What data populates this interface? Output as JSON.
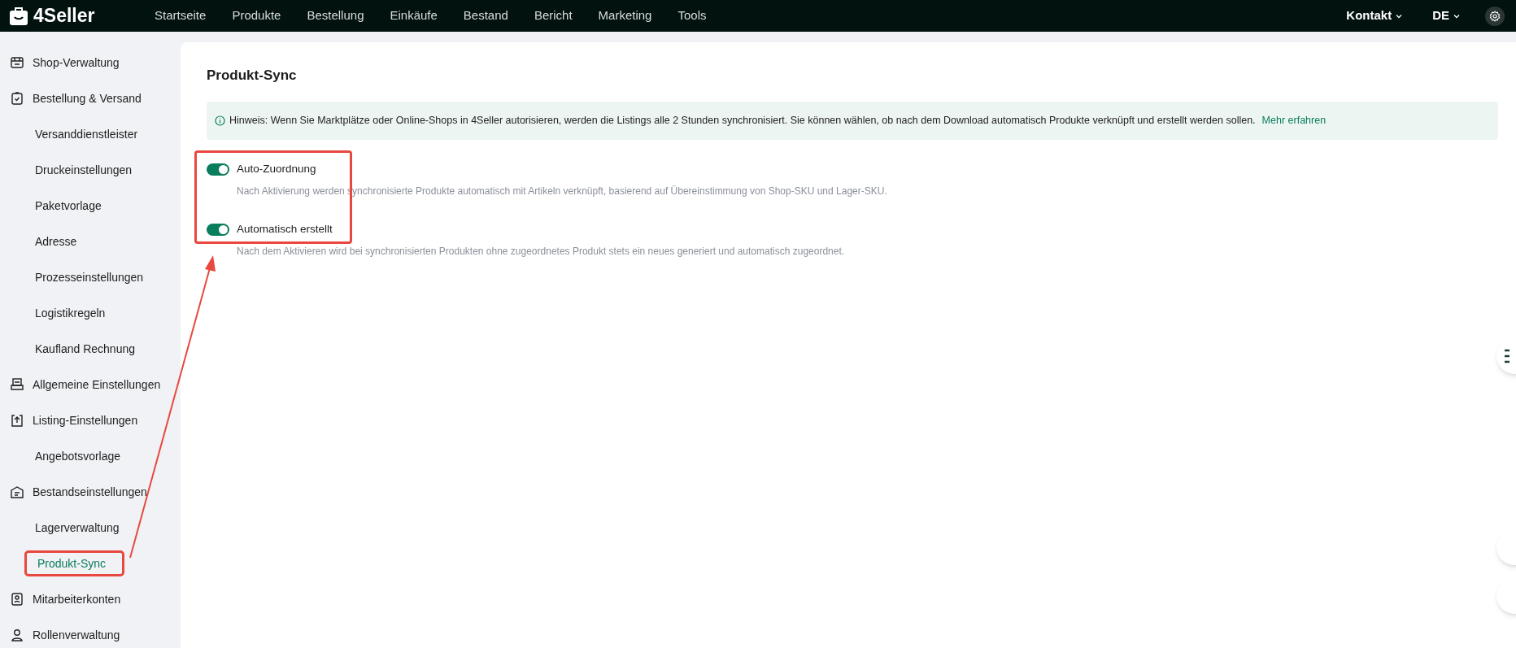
{
  "brand": "4Seller",
  "nav": [
    {
      "label": "Startseite"
    },
    {
      "label": "Produkte"
    },
    {
      "label": "Bestellung"
    },
    {
      "label": "Einkäufe"
    },
    {
      "label": "Bestand"
    },
    {
      "label": "Bericht"
    },
    {
      "label": "Marketing"
    },
    {
      "label": "Tools"
    }
  ],
  "top_right": {
    "contact": "Kontakt",
    "language": "DE"
  },
  "sidebar": [
    {
      "label": "Shop-Verwaltung",
      "selected": false,
      "highlighted": false
    },
    {
      "label": "Bestellung & Versand",
      "selected": false,
      "highlighted": false,
      "children": [
        {
          "label": "Versanddienstleister",
          "selected": false,
          "highlighted": false
        },
        {
          "label": "Druckeinstellungen",
          "selected": false,
          "highlighted": false
        },
        {
          "label": "Paketvorlage",
          "selected": false,
          "highlighted": false
        },
        {
          "label": "Adresse",
          "selected": false,
          "highlighted": false
        },
        {
          "label": "Prozesseinstellungen",
          "selected": false,
          "highlighted": false
        },
        {
          "label": "Logistikregeln",
          "selected": false,
          "highlighted": false
        },
        {
          "label": "Kaufland Rechnung",
          "selected": false,
          "highlighted": false
        }
      ]
    },
    {
      "label": "Allgemeine Einstellungen",
      "selected": false,
      "highlighted": false
    },
    {
      "label": "Listing-Einstellungen",
      "selected": false,
      "highlighted": false,
      "children": [
        {
          "label": "Angebotsvorlage",
          "selected": false,
          "highlighted": false
        }
      ]
    },
    {
      "label": "Bestandseinstellungen",
      "selected": false,
      "highlighted": false,
      "children": [
        {
          "label": "Lagerverwaltung",
          "selected": false,
          "highlighted": false
        },
        {
          "label": "Produkt-Sync",
          "selected": true,
          "highlighted": true
        }
      ]
    },
    {
      "label": "Mitarbeiterkonten",
      "selected": false,
      "highlighted": false
    },
    {
      "label": "Rollenverwaltung",
      "selected": false,
      "highlighted": false
    }
  ],
  "page": {
    "title": "Produkt-Sync",
    "notice": {
      "text": "Hinweis: Wenn Sie Marktplätze oder Online-Shops in 4Seller autorisieren, werden die Listings alle 2 Stunden synchronisiert. Sie können wählen, ob nach dem Download automatisch Produkte verknüpft und erstellt werden sollen.",
      "link": "Mehr erfahren"
    },
    "settings_highlighted": true,
    "settings": [
      {
        "label": "Auto-Zuordnung",
        "on": true,
        "description": "Nach Aktivierung werden synchronisierte Produkte automatisch mit Artikeln verknüpft, basierend auf Übereinstimmung von Shop-SKU und Lager-SKU."
      },
      {
        "label": "Automatisch erstellt",
        "on": true,
        "description": "Nach dem Aktivieren wird bei synchronisierten Produkten ohne zugeordnetes Produkt stets ein neues generiert und automatisch zugeordnet."
      }
    ]
  },
  "annotation_arrow": true
}
